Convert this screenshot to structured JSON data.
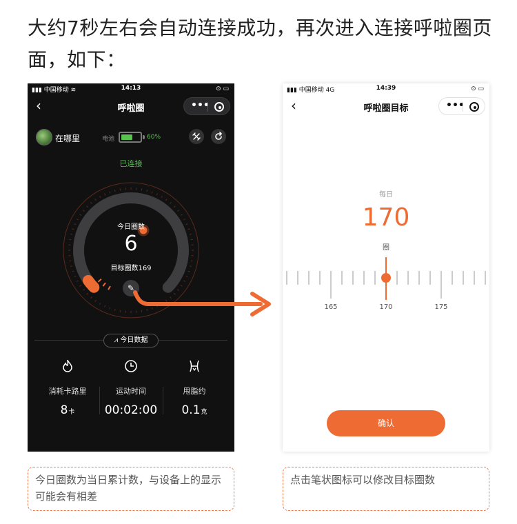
{
  "heading": "大约7秒左右会自动连接成功，再次进入连接呼啦圈页面，如下：",
  "left_phone": {
    "status": {
      "carrier": "▮▮▮ 中国移动 ≋",
      "time": "14:13",
      "right": "⊙ ▭"
    },
    "nav": {
      "back": "‹",
      "title": "呼啦圈"
    },
    "capsule": {
      "dots": "•••"
    },
    "device": {
      "name": "在哪里",
      "battery_label": "电池",
      "battery_percent": "60%",
      "battery_level": 0.6
    },
    "connection_status": "已连接",
    "gauge": {
      "label": "今日圈数",
      "count": "6",
      "target_text": "目标圈数169",
      "progress": 0.036
    },
    "today_data_label": "今日数据",
    "stats": [
      {
        "icon": "flame-icon",
        "label": "消耗卡路里",
        "value": "8",
        "unit": "卡"
      },
      {
        "icon": "clock-icon",
        "label": "运动时间",
        "value": "00:02:00",
        "unit": ""
      },
      {
        "icon": "waist-icon",
        "label": "甩脂约",
        "value": "0.1",
        "unit": "克"
      }
    ]
  },
  "right_phone": {
    "status": {
      "carrier": "▮▮▮ 中国移动  4G",
      "time": "14:39",
      "right": "⊙ ▭"
    },
    "nav": {
      "back": "‹",
      "title": "呼啦圈目标"
    },
    "capsule": {
      "dots": "•••"
    },
    "daily_label": "每日",
    "goal_value": "170",
    "goal_unit": "圈",
    "ruler_labels": [
      "165",
      "170",
      "175"
    ],
    "confirm_label": "确认"
  },
  "notes": {
    "left": "今日圈数为当日累计数，与设备上的显示可能会有相差",
    "right": "点击笔状图标可以修改目标圈数"
  },
  "colors": {
    "accent": "#ee6b33",
    "green": "#57c24e",
    "dark_bg": "#111112"
  }
}
